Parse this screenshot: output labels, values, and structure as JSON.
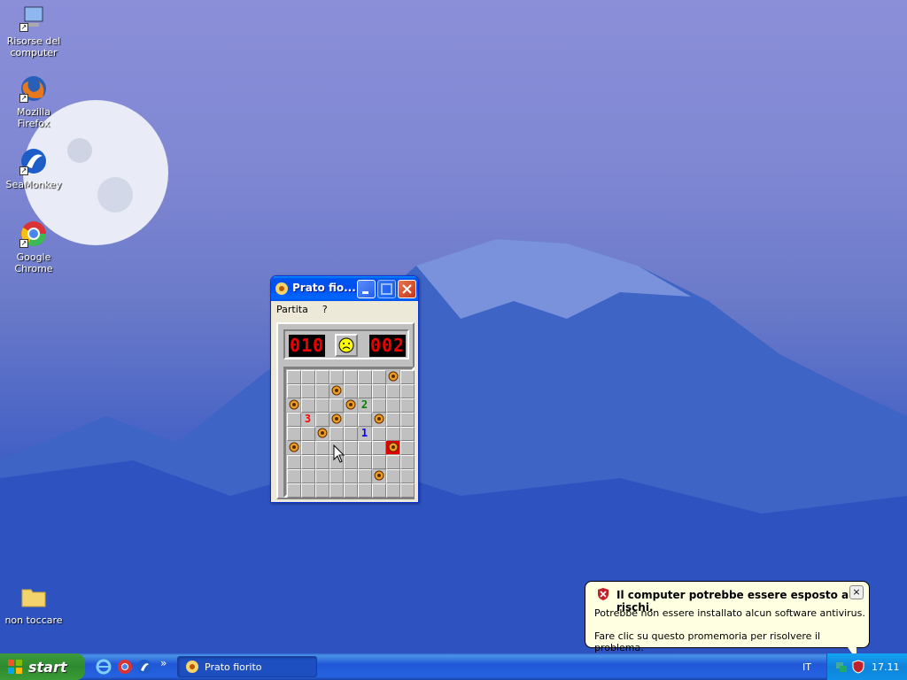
{
  "desktop": {
    "icons": [
      {
        "label": "Risorse del computer",
        "icon": "my-computer-icon"
      },
      {
        "label": "Mozilla Firefox",
        "icon": "firefox-icon"
      },
      {
        "label": "SeaMonkey",
        "icon": "seamonkey-icon"
      },
      {
        "label": "Google Chrome",
        "icon": "chrome-icon"
      },
      {
        "label": "non toccare",
        "icon": "folder-icon"
      }
    ]
  },
  "window": {
    "title": "Prato fio...",
    "menu": [
      "Partita",
      "?"
    ],
    "counter_left": "010",
    "counter_right": "002",
    "face": "sad",
    "grid": [
      [
        "",
        "",
        "",
        "",
        "",
        "",
        "",
        "f",
        ""
      ],
      [
        "",
        "",
        "",
        "f",
        "",
        "",
        "",
        "",
        ""
      ],
      [
        "f",
        "",
        "",
        "",
        "f",
        "2",
        "",
        "",
        ""
      ],
      [
        "",
        "3",
        "",
        "f",
        "",
        "",
        "f",
        "",
        ""
      ],
      [
        "",
        "",
        "f",
        "",
        "",
        "1",
        "",
        "",
        ""
      ],
      [
        "f",
        "",
        "",
        "",
        "",
        "",
        "",
        "X",
        ""
      ],
      [
        "",
        "",
        "",
        "",
        "",
        "",
        "",
        "",
        ""
      ],
      [
        "",
        "",
        "",
        "",
        "",
        "",
        "f",
        "",
        ""
      ],
      [
        "",
        "",
        "",
        "",
        "",
        "",
        "",
        "",
        ""
      ]
    ]
  },
  "taskbar": {
    "start_label": "start",
    "task_label": "Prato fiorito",
    "language": "IT",
    "clock": "17.11"
  },
  "balloon": {
    "title": "Il computer potrebbe essere esposto a rischi.",
    "line1": "Potrebbe non essere installato alcun software antivirus.",
    "line2": "Fare clic su questo promemoria per risolvere il problema.",
    "close": "×"
  },
  "colors": {
    "taskbar": "#2157d7",
    "start_green": "#3c9a3c",
    "titlebar": "#0050ee"
  }
}
